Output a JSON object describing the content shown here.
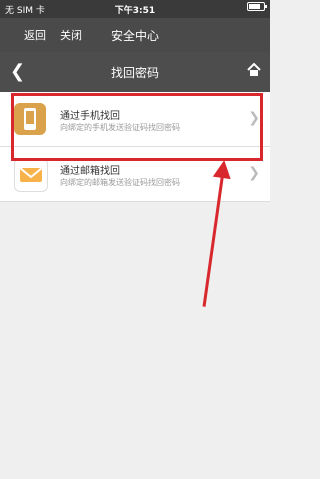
{
  "status_bar": {
    "carrier": "无 SIM 卡",
    "time": "下午3:51"
  },
  "top_bar": {
    "back": "返回",
    "close": "关闭",
    "title": "安全中心"
  },
  "nav_bar": {
    "title": "找回密码"
  },
  "options": [
    {
      "title": "通过手机找回",
      "subtitle": "向绑定的手机发送验证码找回密码",
      "icon": "phone-icon"
    },
    {
      "title": "通过邮箱找回",
      "subtitle": "向绑定的邮箱发送验证码找回密码",
      "icon": "mail-icon"
    }
  ],
  "colors": {
    "accent": "#d9272e",
    "nav_bg": "#4d4d4d"
  }
}
